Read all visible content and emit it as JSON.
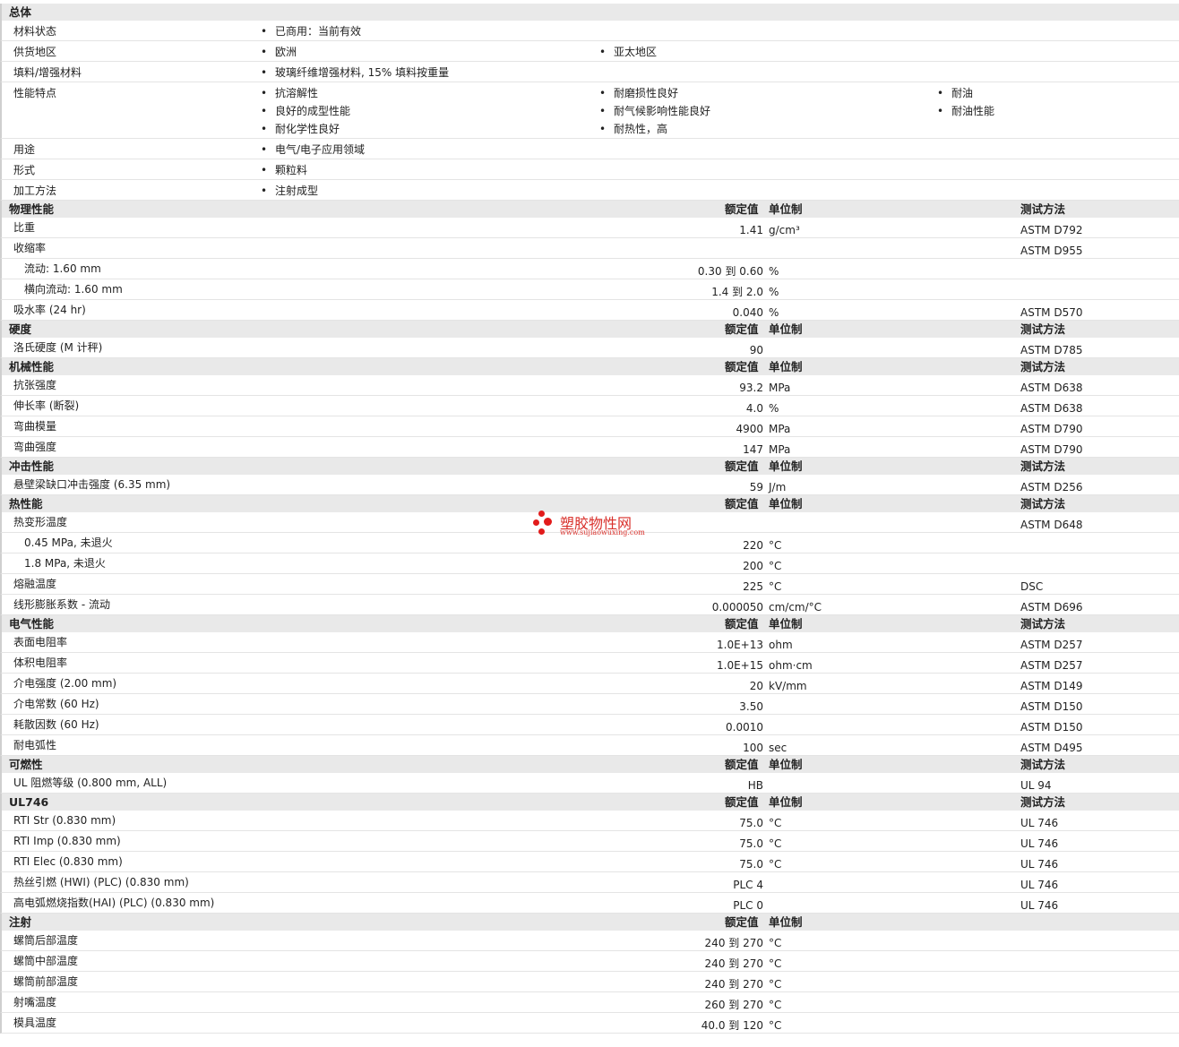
{
  "general": {
    "title": "总体",
    "rows": [
      {
        "label": "材料状态",
        "values": [
          "已商用：当前有效"
        ]
      },
      {
        "label": "供货地区",
        "values": [
          "欧洲",
          "亚太地区"
        ]
      },
      {
        "label": "填料/增强材料",
        "values": [
          "玻璃纤维增强材料, 15% 填料按重量"
        ]
      },
      {
        "label": "性能特点",
        "values": [
          "抗溶解性",
          "耐磨损性良好",
          "耐油",
          "良好的成型性能",
          "耐气候影响性能良好",
          "耐油性能",
          "耐化学性良好",
          "耐热性，高"
        ]
      },
      {
        "label": "用途",
        "values": [
          "电气/电子应用领域"
        ]
      },
      {
        "label": "形式",
        "values": [
          "颗粒料"
        ]
      },
      {
        "label": "加工方法",
        "values": [
          "注射成型"
        ]
      }
    ]
  },
  "column_labels": {
    "value": "额定值",
    "unit": "单位制",
    "method": "测试方法"
  },
  "sections": [
    {
      "title": "物理性能",
      "rows": [
        {
          "label": "比重",
          "value": "1.41",
          "unit": "g/cm³",
          "method": "ASTM D792"
        },
        {
          "label": "收缩率",
          "value": "",
          "unit": "",
          "method": "ASTM D955"
        },
        {
          "label": "流动: 1.60 mm",
          "value": "0.30 到  0.60",
          "unit": "%",
          "method": "",
          "indent": true
        },
        {
          "label": "横向流动: 1.60 mm",
          "value": "1.4 到  2.0",
          "unit": "%",
          "method": "",
          "indent": true
        },
        {
          "label": "吸水率  (24 hr)",
          "value": "0.040",
          "unit": "%",
          "method": "ASTM D570"
        }
      ]
    },
    {
      "title": "硬度",
      "rows": [
        {
          "label": "洛氏硬度  (M 计秤)",
          "value": "90",
          "unit": "",
          "method": "ASTM D785"
        }
      ]
    },
    {
      "title": "机械性能",
      "rows": [
        {
          "label": "抗张强度",
          "value": "93.2",
          "unit": "MPa",
          "method": "ASTM D638"
        },
        {
          "label": "伸长率  (断裂)",
          "value": "4.0",
          "unit": "%",
          "method": "ASTM D638"
        },
        {
          "label": "弯曲模量",
          "value": "4900",
          "unit": "MPa",
          "method": "ASTM D790"
        },
        {
          "label": "弯曲强度",
          "value": "147",
          "unit": "MPa",
          "method": "ASTM D790"
        }
      ]
    },
    {
      "title": "冲击性能",
      "rows": [
        {
          "label": "悬壁梁缺口冲击强度  (6.35 mm)",
          "value": "59",
          "unit": "J/m",
          "method": "ASTM D256"
        }
      ]
    },
    {
      "title": "热性能",
      "rows": [
        {
          "label": "热变形温度",
          "value": "",
          "unit": "",
          "method": "ASTM D648"
        },
        {
          "label": "0.45 MPa, 未退火",
          "value": "220",
          "unit": "°C",
          "method": "",
          "indent": true
        },
        {
          "label": "1.8 MPa, 未退火",
          "value": "200",
          "unit": "°C",
          "method": "",
          "indent": true
        },
        {
          "label": "熔融温度",
          "value": "225",
          "unit": "°C",
          "method": "DSC"
        },
        {
          "label": "线形膨胀系数  - 流动",
          "value": "0.000050",
          "unit": "cm/cm/°C",
          "method": "ASTM D696"
        }
      ]
    },
    {
      "title": "电气性能",
      "rows": [
        {
          "label": "表面电阻率",
          "value": "1.0E+13",
          "unit": "ohm",
          "method": "ASTM D257"
        },
        {
          "label": "体积电阻率",
          "value": "1.0E+15",
          "unit": "ohm·cm",
          "method": "ASTM D257"
        },
        {
          "label": "介电强度  (2.00 mm)",
          "value": "20",
          "unit": "kV/mm",
          "method": "ASTM D149"
        },
        {
          "label": "介电常数  (60 Hz)",
          "value": "3.50",
          "unit": "",
          "method": "ASTM D150"
        },
        {
          "label": "耗散因数  (60 Hz)",
          "value": "0.0010",
          "unit": "",
          "method": "ASTM D150"
        },
        {
          "label": "耐电弧性",
          "value": "100",
          "unit": "sec",
          "method": "ASTM D495"
        }
      ]
    },
    {
      "title": "可燃性",
      "rows": [
        {
          "label": "UL 阻燃等级  (0.800 mm, ALL)",
          "value": "HB",
          "unit": "",
          "method": "UL 94"
        }
      ]
    },
    {
      "title": "UL746",
      "rows": [
        {
          "label": "RTI Str (0.830 mm)",
          "value": "75.0",
          "unit": "°C",
          "method": "UL 746"
        },
        {
          "label": "RTI Imp (0.830 mm)",
          "value": "75.0",
          "unit": "°C",
          "method": "UL 746"
        },
        {
          "label": "RTI Elec (0.830 mm)",
          "value": "75.0",
          "unit": "°C",
          "method": "UL 746"
        },
        {
          "label": "热丝引燃  (HWI) (PLC) (0.830 mm)",
          "value": "PLC 4",
          "unit": "",
          "method": "UL 746"
        },
        {
          "label": "高电弧燃烧指数(HAI) (PLC) (0.830 mm)",
          "value": "PLC 0",
          "unit": "",
          "method": "UL 746"
        }
      ]
    },
    {
      "title": "注射",
      "no_method": true,
      "rows": [
        {
          "label": "螺筒后部温度",
          "value": "240 到  270",
          "unit": "°C",
          "method": ""
        },
        {
          "label": "螺筒中部温度",
          "value": "240 到  270",
          "unit": "°C",
          "method": ""
        },
        {
          "label": "螺筒前部温度",
          "value": "240 到  270",
          "unit": "°C",
          "method": ""
        },
        {
          "label": "射嘴温度",
          "value": "260 到  270",
          "unit": "°C",
          "method": ""
        },
        {
          "label": "模具温度",
          "value": "40.0 到  120",
          "unit": "°C",
          "method": ""
        }
      ]
    }
  ],
  "watermark": {
    "name": "塑胶物性网",
    "url": "www.sujiaowuxing.com"
  }
}
